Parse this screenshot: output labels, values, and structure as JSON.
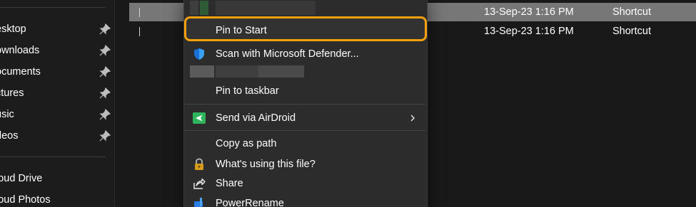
{
  "sidebar": {
    "items": [
      {
        "label": "esktop",
        "icon": "pin-icon"
      },
      {
        "label": "ownloads",
        "icon": "pin-icon"
      },
      {
        "label": "ocuments",
        "icon": "pin-icon"
      },
      {
        "label": "ctures",
        "icon": "pin-icon"
      },
      {
        "label": "usic",
        "icon": "pin-icon"
      },
      {
        "label": "deos",
        "icon": "pin-icon"
      },
      {
        "label": "loud Drive"
      },
      {
        "label": "loud Photos"
      }
    ]
  },
  "files": [
    {
      "date": "13-Sep-23 1:16 PM",
      "type": "Shortcut",
      "selected": true
    },
    {
      "date": "13-Sep-23 1:16 PM",
      "type": "Shortcut",
      "selected": false
    }
  ],
  "context_menu": {
    "items": [
      {
        "label": "Pin to Start",
        "highlighted": true
      },
      {
        "label": "Scan with Microsoft Defender...",
        "icon": "defender-shield-icon"
      },
      {
        "label": "Pin to taskbar"
      },
      {
        "label": "Send via AirDroid",
        "icon": "airdroid-icon",
        "has_submenu": true
      },
      {
        "label": "Copy as path"
      },
      {
        "label": "What's using this file?",
        "icon": "lock-icon"
      },
      {
        "label": "Share",
        "icon": "share-icon"
      },
      {
        "label": "PowerRename",
        "icon": "powerrename-icon"
      }
    ],
    "highlight_color": "#f5a00d"
  },
  "colors": {
    "background": "#191919",
    "selected_row": "#777777",
    "menu_background": "#2c2c2c"
  }
}
